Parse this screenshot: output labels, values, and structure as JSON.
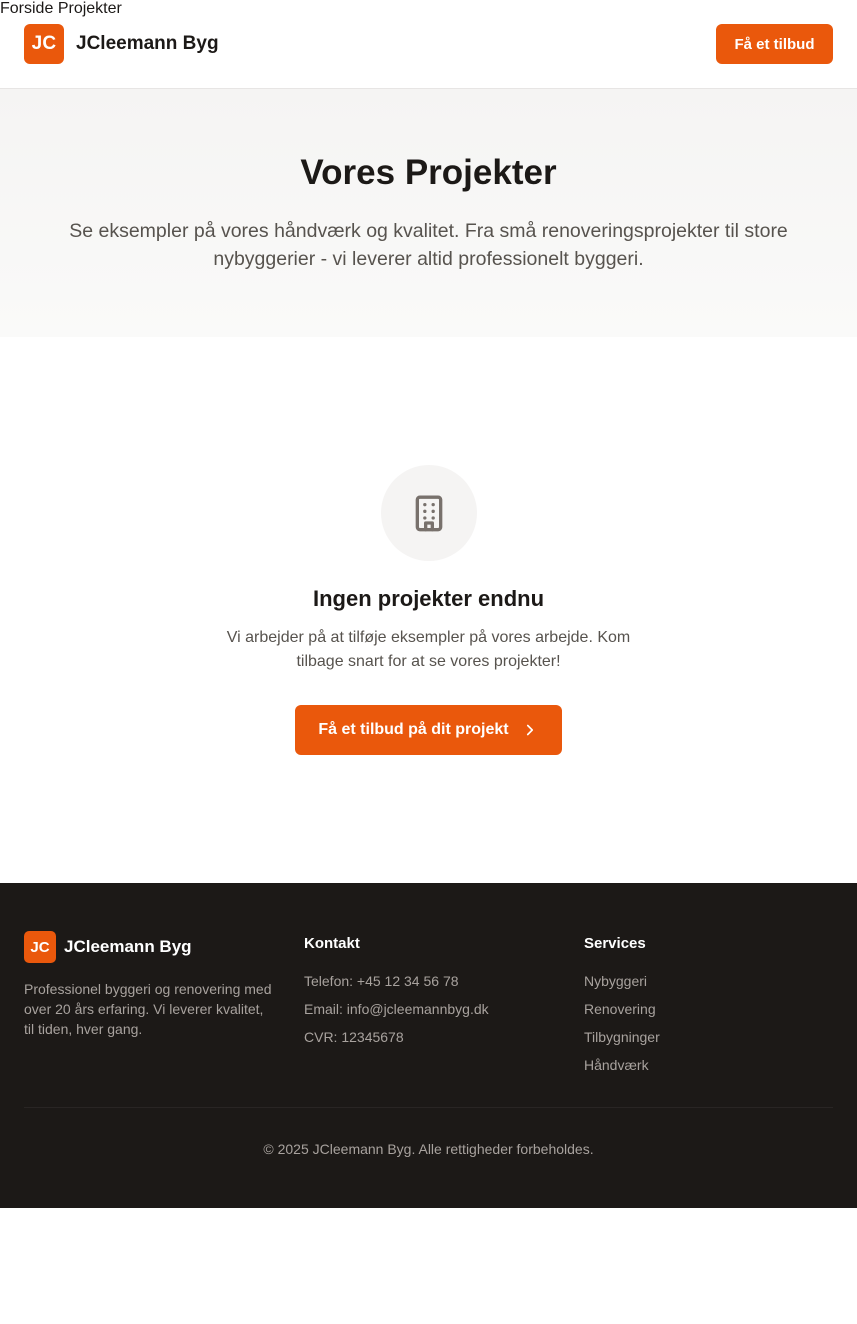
{
  "header": {
    "logo_initials": "JC",
    "brand_name": "JCleemann Byg",
    "nav": [
      {
        "label": "Forside"
      },
      {
        "label": "Projekter"
      }
    ],
    "cta_label": "Få et tilbud"
  },
  "hero": {
    "title": "Vores Projekter",
    "subtitle": "Se eksempler på vores håndværk og kvalitet. Fra små renoveringsprojekter til store nybyggerier - vi leverer altid professionelt byggeri."
  },
  "empty_state": {
    "icon": "building-icon",
    "title": "Ingen projekter endnu",
    "text": "Vi arbejder på at tilføje eksempler på vores arbejde. Kom tilbage snart for at se vores projekter!",
    "cta_label": "Få et tilbud på dit projekt"
  },
  "footer": {
    "logo_initials": "JC",
    "brand_name": "JCleemann Byg",
    "description": "Professionel byggeri og renovering med over 20 års erfaring. Vi leverer kvalitet, til tiden, hver gang.",
    "contact": {
      "heading": "Kontakt",
      "items": [
        "Telefon: +45 12 34 56 78",
        "Email: info@jcleemannbyg.dk",
        "CVR: 12345678"
      ]
    },
    "services": {
      "heading": "Services",
      "items": [
        "Nybyggeri",
        "Renovering",
        "Tilbygninger",
        "Håndværk"
      ]
    },
    "copyright": "© 2025 JCleemann Byg. Alle rettigheder forbeholdes."
  },
  "colors": {
    "accent": "#ea580c",
    "footer_bg": "#1c1917",
    "text_dark": "#1c1917",
    "text_muted": "#57534e"
  }
}
